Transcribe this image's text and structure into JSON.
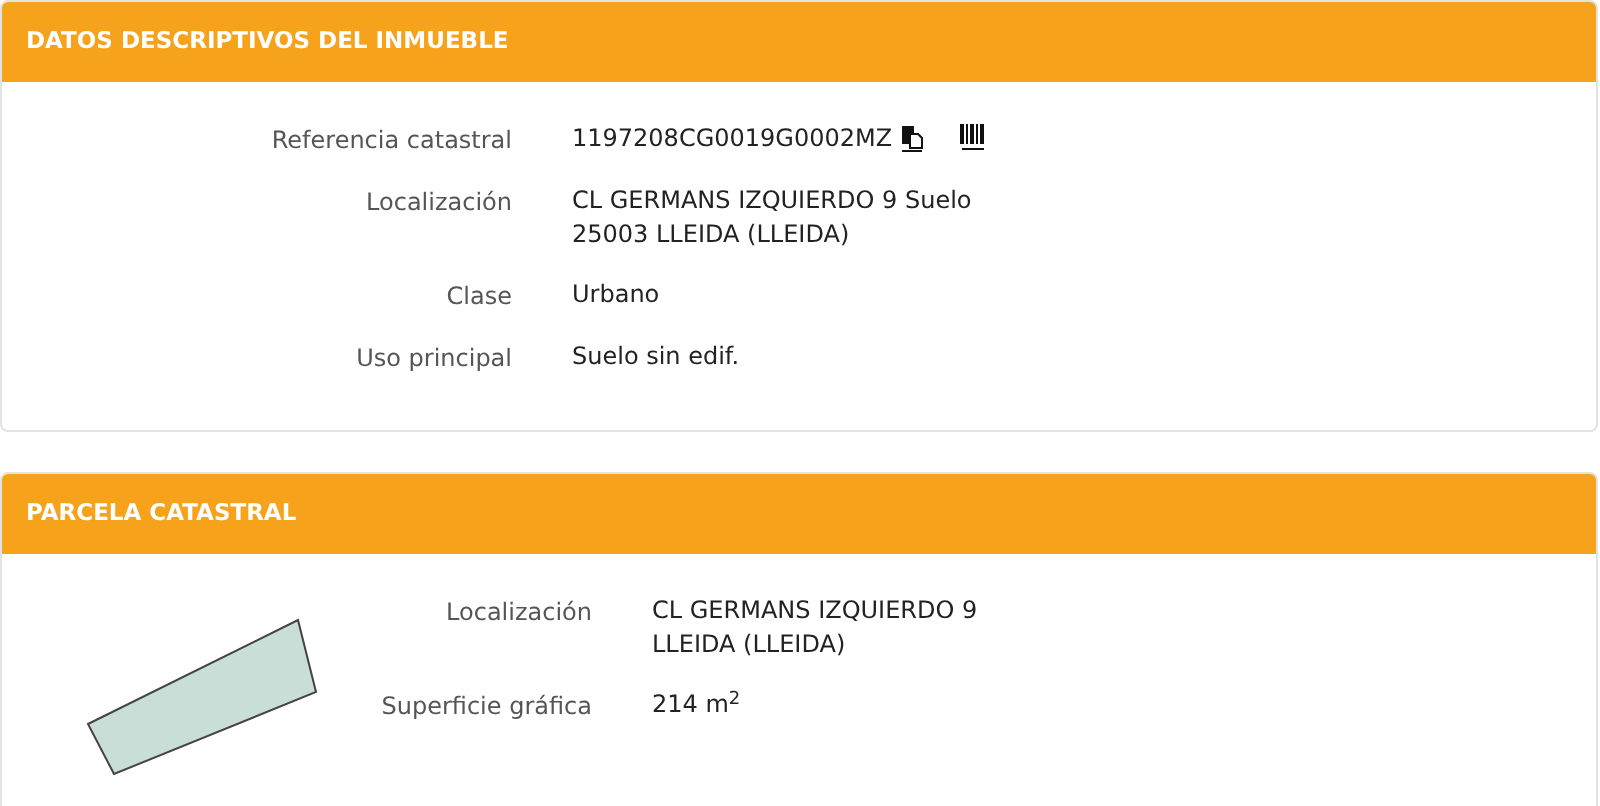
{
  "sections": [
    {
      "title": "DATOS DESCRIPTIVOS DEL INMUEBLE",
      "kind": "details",
      "fields": [
        {
          "label": "Referencia catastral",
          "lines": [
            "1197208CG0019G0002MZ"
          ],
          "icons": true
        },
        {
          "label": "Localización",
          "lines": [
            "CL GERMANS IZQUIERDO 9 Suelo",
            "25003 LLEIDA (LLEIDA)"
          ]
        },
        {
          "label": "Clase",
          "lines": [
            "Urbano"
          ]
        },
        {
          "label": "Uso principal",
          "lines": [
            "Suelo sin edif."
          ]
        }
      ]
    },
    {
      "title": "PARCELA CATASTRAL",
      "kind": "parcel",
      "fields": [
        {
          "label": "Localización",
          "lines": [
            "CL GERMANS IZQUIERDO 9",
            "LLEIDA (LLEIDA)"
          ]
        },
        {
          "label": "Superficie gráfica",
          "lines": [
            "214 m$^{2}$"
          ]
        }
      ]
    }
  ]
}
